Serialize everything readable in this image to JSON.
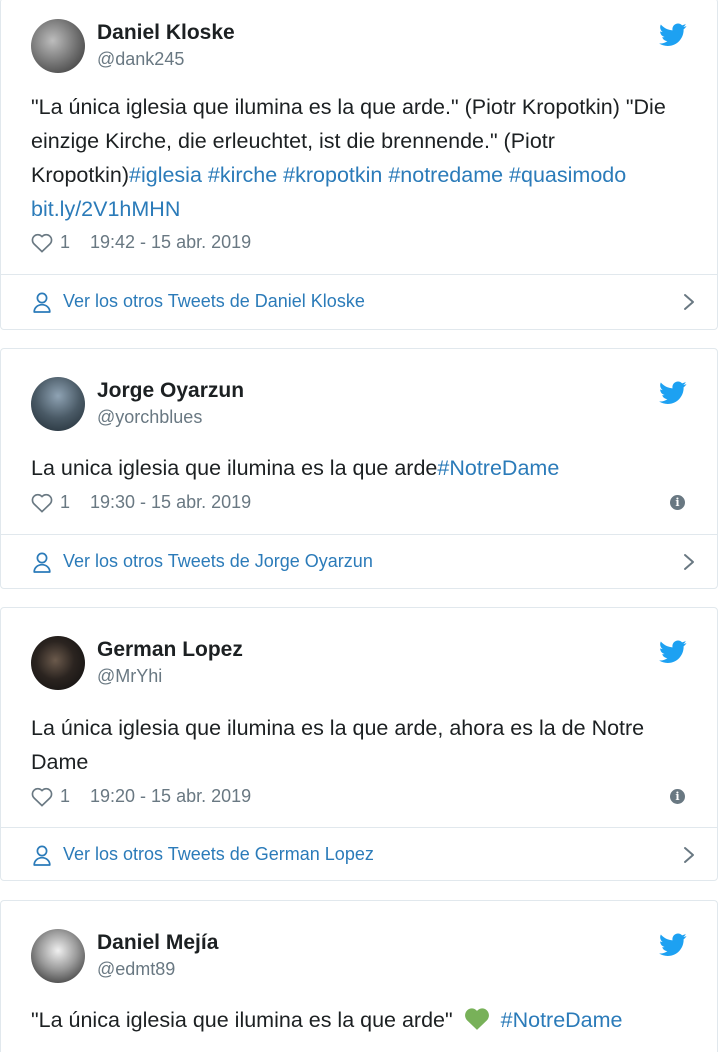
{
  "colors": {
    "link": "#2b7bb9",
    "twitter_blue": "#1da1f2",
    "meta_gray": "#697882",
    "heart_green": "#78b159"
  },
  "tweets": [
    {
      "name": "Daniel Kloske",
      "handle": "@dank245",
      "text_plain": "\"La única iglesia que ilumina es la que arde.\" (Piotr Kropotkin) \"Die einzige Kirche, die erleuchtet, ist die brennende.\" (Piotr Kropotkin)",
      "hashtags": "#iglesia #kirche #kropotkin #notredame #quasimodo",
      "link": "bit.ly/2V1hMHN",
      "likes": "1",
      "time": "19:42 - 15 abr. 2019",
      "more_label": "Ver los otros Tweets de Daniel Kloske"
    },
    {
      "name": "Jorge Oyarzun",
      "handle": "@yorchblues",
      "text_plain": "La unica iglesia que ilumina es la que arde",
      "hashtags": "#NotreDame",
      "likes": "1",
      "time": "19:30 - 15 abr. 2019",
      "info_icon": "i",
      "more_label": "Ver los otros Tweets de Jorge Oyarzun"
    },
    {
      "name": "German Lopez",
      "handle": "@MrYhi",
      "text_plain": "La única iglesia que ilumina es la que arde, ahora es la de Notre Dame",
      "likes": "1",
      "time": "19:20 - 15 abr. 2019",
      "info_icon": "i",
      "more_label": "Ver los otros Tweets de German Lopez"
    },
    {
      "name": "Daniel Mejía",
      "handle": "@edmt89",
      "text_plain": "\"La única iglesia que ilumina es la que arde\"",
      "emoji": "green-heart",
      "hashtags": "#NotreDame"
    }
  ],
  "icons": {
    "avatar": "avatar-icon",
    "bird": "twitter-bird-icon",
    "heart": "heart-outline-icon",
    "info": "info-icon",
    "person": "person-icon",
    "chevron": "chevron-right-icon"
  }
}
